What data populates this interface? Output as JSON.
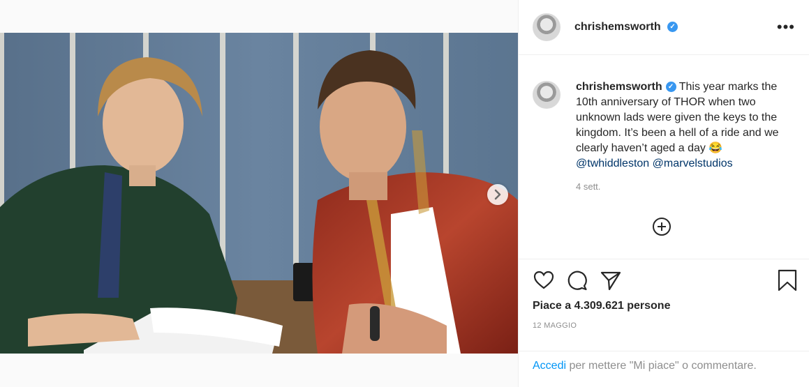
{
  "post": {
    "username": "chrishemsworth",
    "verified_glyph": "✓",
    "more_glyph": "•••",
    "caption_text": "This year marks the 10th anniversary of THOR when two unknown lads were given the keys to the kingdom. It’s been a hell of a ride and we clearly haven’t aged a day",
    "emoji": "😂",
    "mention_1": "@twhiddleston",
    "mention_2": "@marvelstudios",
    "time_ago": "4 sett.",
    "likes": "Piace a 4.309.621 persone",
    "date": "12 MAGGIO",
    "login_link": "Accedi",
    "login_rest": " per mettere \"Mi piace\" o commentare."
  },
  "icons": {
    "more": "more-options-icon",
    "add_comment": "add-comment-icon",
    "like": "heart-icon",
    "comment": "comment-icon",
    "share": "share-icon",
    "save": "bookmark-icon",
    "next": "chevron-right-icon"
  },
  "colors": {
    "verified": "#3897f0",
    "link": "#0095f6",
    "mention": "#003569",
    "muted": "#8e8e8e"
  }
}
